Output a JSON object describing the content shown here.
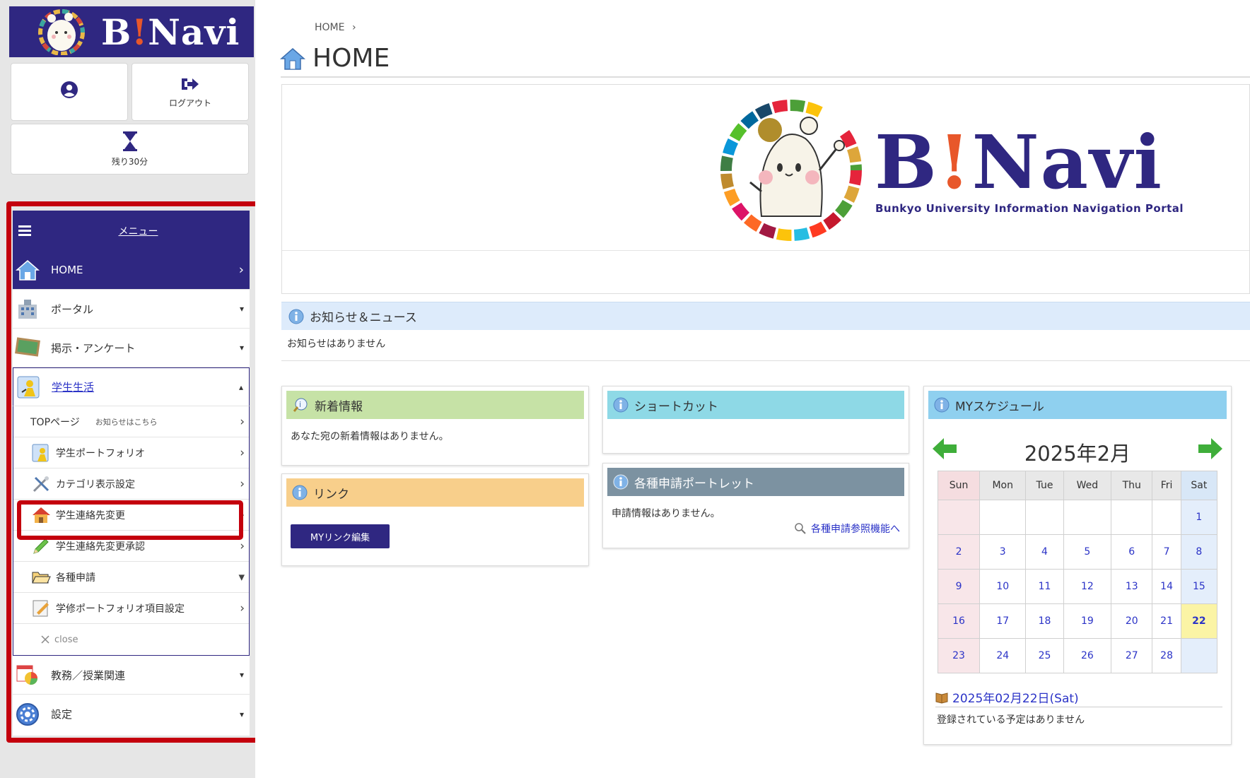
{
  "app": {
    "logo_text_pre": "B",
    "logo_text_excl": "!",
    "logo_text_post": "Navi"
  },
  "account": {
    "user_label": "",
    "logout_label": "ログアウト",
    "timer_label": "残り30分"
  },
  "menu": {
    "title": "メニュー",
    "items": [
      {
        "label": "HOME",
        "icon": "home-icon",
        "arrow": "›",
        "active": true
      },
      {
        "label": "ポータル",
        "icon": "building-icon",
        "arrow": "▾"
      },
      {
        "label": "掲示・アンケート",
        "icon": "board-icon",
        "arrow": "▾"
      },
      {
        "label": "学生生活",
        "icon": "student-life-icon",
        "arrow": "▴",
        "open": true
      },
      {
        "label": "教務／授業関連",
        "icon": "calendar-chart-icon",
        "arrow": "▾"
      },
      {
        "label": "設定",
        "icon": "settings-icon",
        "arrow": "▾"
      }
    ],
    "subitems": [
      {
        "label": "TOPページ",
        "note": "お知らせはこちら",
        "arrow": "›"
      },
      {
        "label": "学生ポートフォリオ",
        "icon": "portfolio-icon",
        "arrow": "›"
      },
      {
        "label": "カテゴリ表示設定",
        "icon": "tools-icon",
        "arrow": "›"
      },
      {
        "label": "学生連絡先変更",
        "icon": "house-icon",
        "arrow": "›",
        "highlighted": true
      },
      {
        "label": "学生連絡先変更承認",
        "icon": "pencil-icon",
        "arrow": "›"
      },
      {
        "label": "各種申請",
        "icon": "folder-icon",
        "arrow": "▾"
      },
      {
        "label": "学修ポートフォリオ項目設定",
        "icon": "memo-icon",
        "arrow": "›"
      },
      {
        "label": "close",
        "icon": "close-icon"
      }
    ]
  },
  "breadcrumb": {
    "home": "HOME",
    "sep": "›"
  },
  "page": {
    "title": "HOME"
  },
  "banner": {
    "title_pre": "B",
    "title_excl": "!",
    "title_post": "Navi",
    "subtitle": "Bunkyo University Information Navigation Portal"
  },
  "news": {
    "title": "お知らせ＆ニュース",
    "empty": "お知らせはありません"
  },
  "new_info": {
    "title": "新着情報",
    "empty": "あなた宛の新着情報はありません。"
  },
  "links": {
    "title": "リンク",
    "button": "MYリンク編集"
  },
  "shortcut": {
    "title": "ショートカット"
  },
  "applications": {
    "title": "各種申請ポートレット",
    "empty": "申請情報はありません。",
    "link": "各種申請参照機能へ"
  },
  "schedule": {
    "title": "MYスケジュール",
    "month_title": "2025年2月",
    "weekdays": [
      "Sun",
      "Mon",
      "Tue",
      "Wed",
      "Thu",
      "Fri",
      "Sat"
    ],
    "weeks": [
      [
        "",
        "",
        "",
        "",
        "",
        "",
        "1"
      ],
      [
        "2",
        "3",
        "4",
        "5",
        "6",
        "7",
        "8"
      ],
      [
        "9",
        "10",
        "11",
        "12",
        "13",
        "14",
        "15"
      ],
      [
        "16",
        "17",
        "18",
        "19",
        "20",
        "21",
        "22"
      ],
      [
        "23",
        "24",
        "25",
        "26",
        "27",
        "28",
        ""
      ]
    ],
    "today": "22",
    "selected_date": "2025年02月22日(Sat)",
    "empty": "登録されている予定はありません"
  },
  "colors": {
    "brand": "#2f2781",
    "accent": "#e8572a",
    "highlight": "#c4000d",
    "link": "#2b33c7"
  }
}
